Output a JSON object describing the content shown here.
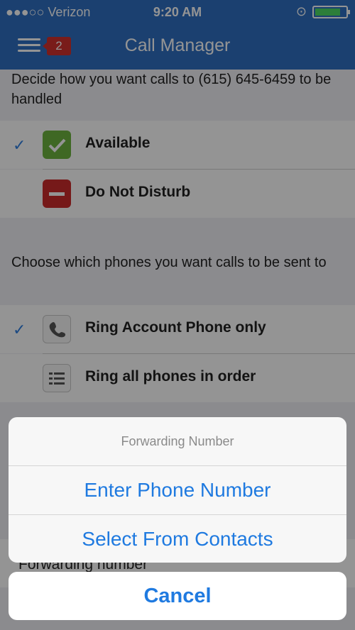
{
  "status": {
    "carrier": "●●●○○ Verizon",
    "time": "9:20 AM"
  },
  "header": {
    "badge": "2",
    "title": "Call Manager"
  },
  "handling": {
    "description": "Decide how you want calls to (615) 645-6459 to be handled",
    "items": [
      {
        "label": "Available"
      },
      {
        "label": "Do Not Disturb"
      }
    ]
  },
  "phones": {
    "description": "Choose which phones you want calls to be sent to",
    "items": [
      {
        "label": "Ring Account Phone only"
      },
      {
        "label": "Ring all phones in order"
      }
    ]
  },
  "background_row": {
    "label": "Forwarding number"
  },
  "action_sheet": {
    "title": "Forwarding Number",
    "buttons": [
      {
        "label": "Enter Phone Number"
      },
      {
        "label": "Select From Contacts"
      }
    ],
    "cancel": "Cancel"
  },
  "colors": {
    "accent": "#2f6fc1",
    "link": "#1f7ae0",
    "available": "#6db33f",
    "dnd": "#cc2b2b"
  }
}
